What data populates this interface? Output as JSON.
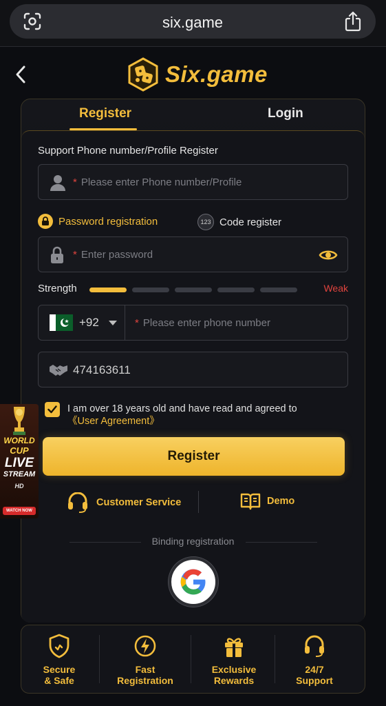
{
  "browser": {
    "url": "six.game",
    "icons": [
      "lens-icon",
      "share-icon"
    ]
  },
  "header": {
    "brand": "Six.game",
    "back_icon": "chevron-left-icon"
  },
  "tabs": [
    {
      "label": "Register",
      "active": true
    },
    {
      "label": "Login",
      "active": false
    }
  ],
  "form": {
    "section_label": "Support Phone number/Profile Register",
    "profile_placeholder": "Please enter Phone number/Profile",
    "options": {
      "password_registration": "Password registration",
      "code_register": "Code register",
      "code_badge": "123"
    },
    "password_placeholder": "Enter password",
    "strength": {
      "label": "Strength",
      "level": 1,
      "total": 6,
      "value": "Weak"
    },
    "country": {
      "dial_code": "+92",
      "flag": "pakistan-flag-icon"
    },
    "phone_placeholder": "Please enter phone number",
    "invite_code": "474163611",
    "required_marker": "*",
    "agreement": {
      "checked": true,
      "text": "I am over 18 years old and have read and agreed to",
      "link": "《User Agreement》"
    },
    "register_button": "Register",
    "customer_service": "Customer Service",
    "demo": "Demo",
    "binding_label": "Binding registration"
  },
  "features": [
    {
      "line1": "Secure",
      "line2": "& Safe",
      "icon": "shield-icon"
    },
    {
      "line1": "Fast",
      "line2": "Registration",
      "icon": "lightning-icon"
    },
    {
      "line1": "Exclusive",
      "line2": "Rewards",
      "icon": "gift-icon"
    },
    {
      "line1": "24/7",
      "line2": "Support",
      "icon": "headset-icon"
    }
  ],
  "banner": {
    "line1": "WORLD",
    "line2": "CUP",
    "line3": "LIVE",
    "line4": "STREAM",
    "badge": "HD",
    "cta": "WATCH NOW"
  },
  "colors": {
    "accent": "#f3bd3c",
    "danger": "#e0443e",
    "background": "#0c0d11"
  }
}
